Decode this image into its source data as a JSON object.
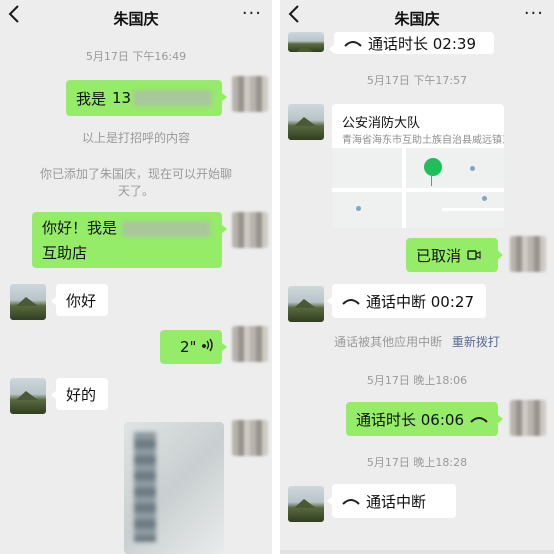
{
  "left": {
    "title": "朱国庆",
    "back_icon": "chevron-left-icon",
    "more_label": "···",
    "time1": "5月17日 下午16:49",
    "msg_phone_prefix": "我是",
    "msg_phone_visible": "13",
    "sys_greeting_note": "以上是打招呼的内容",
    "sys_added_note_line1": "你已添加了朱国庆，现在可以开始聊",
    "sys_added_note_line2": "天了。",
    "msg_hello_prefix": "你好！我是",
    "msg_hello_suffix": "互助店",
    "msg_reply1": "你好",
    "voice_duration": "2\"",
    "msg_reply2": "好的"
  },
  "right": {
    "title": "朱国庆",
    "top_call_label": "通话时长 02:39",
    "time2": "5月17日 下午17:57",
    "location_title": "公安消防大队",
    "location_address": "青海省海东市互助土族自治县威远镇东...",
    "cancelled_label": "已取消",
    "interrupted_label_1": "通话中断 00:27",
    "sys_interrupted_note": "通话被其他应用中断",
    "redial_link": "重新拨打",
    "time3": "5月17日 晚上18:06",
    "duration_label": "通话时长 06:06",
    "time4": "5月17日 晚上18:28",
    "interrupted_label_2": "通话中断"
  },
  "colors": {
    "chat_bg": "#ededed",
    "sent_bubble": "#95ec69",
    "received_bubble": "#ffffff",
    "link": "#576b95",
    "timestamp": "#9a9a9a"
  }
}
